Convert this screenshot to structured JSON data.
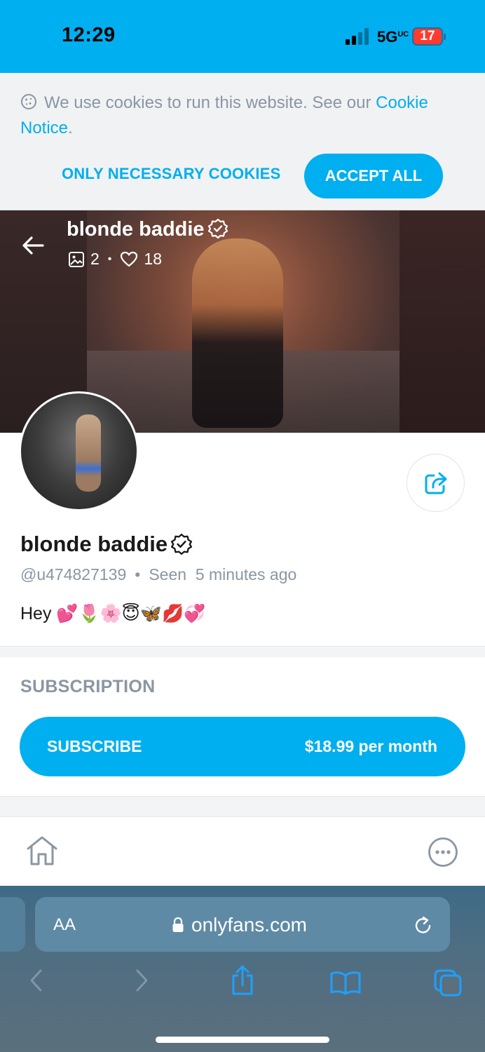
{
  "status_bar": {
    "time": "12:29",
    "network": "5G",
    "network_suffix": "UC",
    "battery": "17"
  },
  "cookie_banner": {
    "text": "We use cookies to run this website. See our ",
    "link": "Cookie Notice",
    "link_suffix": ".",
    "necessary_label": "ONLY NECESSARY COOKIES",
    "accept_label": "ACCEPT ALL"
  },
  "cover": {
    "name": "blonde baddie",
    "media_count": "2",
    "likes_count": "18"
  },
  "profile": {
    "name": "blonde baddie",
    "handle": "@u474827139",
    "separator": "•",
    "seen_label": "Seen",
    "seen_time": "5 minutes ago",
    "bio": "Hey 💕🌷🌸😇🦋💋💞"
  },
  "subscription": {
    "heading": "SUBSCRIPTION",
    "button_label": "SUBSCRIBE",
    "price": "$18.99 per month"
  },
  "safari": {
    "text_size_label": "AA",
    "url": "onlyfans.com"
  },
  "colors": {
    "brand": "#00aff0",
    "muted": "#8a96a3"
  }
}
